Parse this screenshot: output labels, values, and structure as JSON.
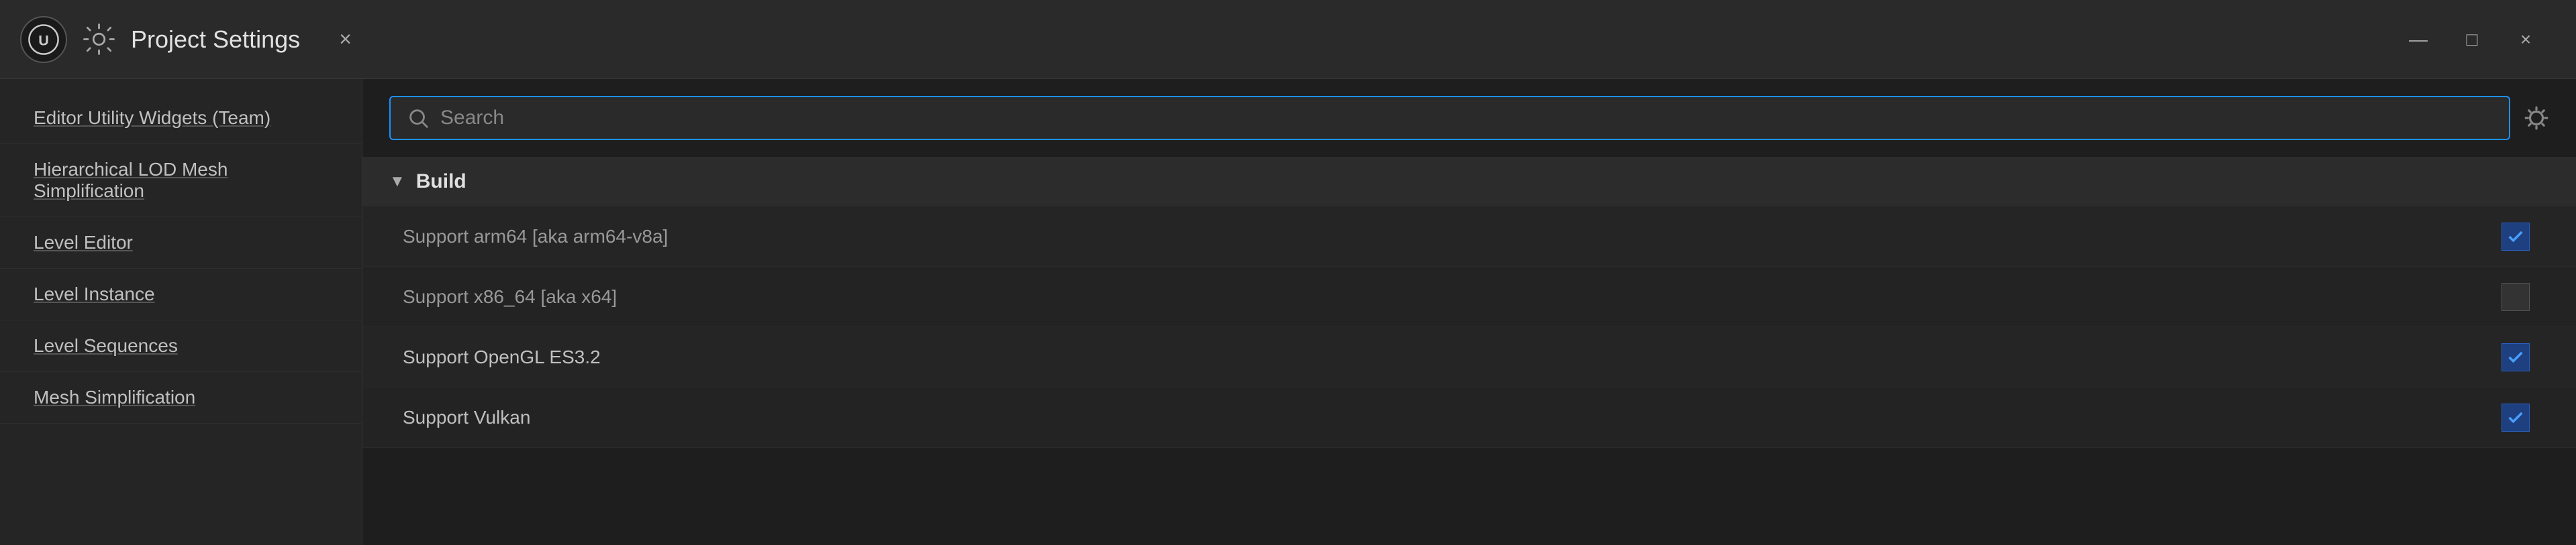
{
  "titleBar": {
    "title": "Project Settings",
    "closeLabel": "×",
    "minimizeLabel": "—",
    "maximizeLabel": "□",
    "windowCloseLabel": "×"
  },
  "sidebar": {
    "items": [
      {
        "label": "Editor Utility Widgets (Team)"
      },
      {
        "label": "Hierarchical LOD Mesh Simplification"
      },
      {
        "label": "Level Editor"
      },
      {
        "label": "Level Instance"
      },
      {
        "label": "Level Sequences"
      },
      {
        "label": "Mesh Simplification"
      }
    ]
  },
  "searchBar": {
    "placeholder": "Search"
  },
  "sections": [
    {
      "title": "Build",
      "rows": [
        {
          "label": "Support arm64 [aka arm64-v8a]",
          "checked": true,
          "labelEnabled": false
        },
        {
          "label": "Support x86_64 [aka x64]",
          "checked": false,
          "labelEnabled": false
        },
        {
          "label": "Support OpenGL ES3.2",
          "checked": true,
          "labelEnabled": true
        },
        {
          "label": "Support Vulkan",
          "checked": true,
          "labelEnabled": true
        }
      ]
    }
  ]
}
